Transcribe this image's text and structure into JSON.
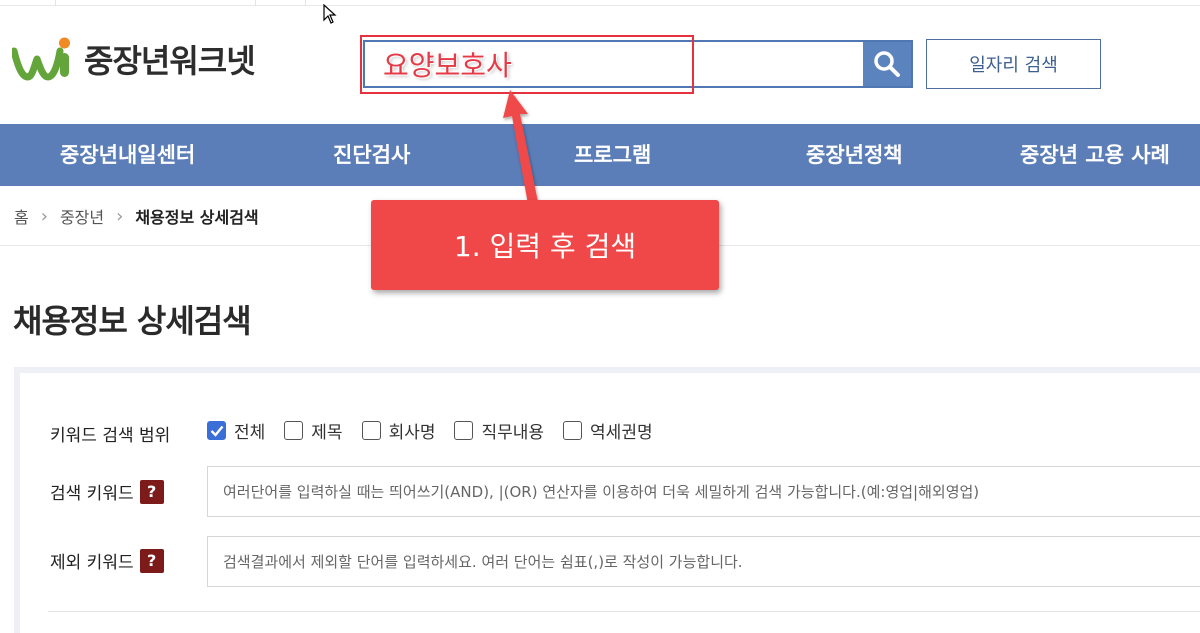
{
  "header": {
    "logo_text": "중장년워크넷",
    "search_value": "요양보호사",
    "search_button_icon": "search-icon",
    "job_search_label": "일자리 검색"
  },
  "nav": {
    "items": [
      {
        "label": "중장년내일센터"
      },
      {
        "label": "진단검사"
      },
      {
        "label": "프로그램"
      },
      {
        "label": "중장년정책"
      },
      {
        "label": "중장년 고용 사례"
      }
    ]
  },
  "breadcrumb": {
    "items": [
      "홈",
      "중장년",
      "채용정보 상세검색"
    ]
  },
  "annotation": {
    "callout_text": "1. 입력 후 검색",
    "color": "#f04848"
  },
  "page": {
    "title": "채용정보 상세검색"
  },
  "form": {
    "scope_label": "키워드 검색 범위",
    "scope_options": [
      {
        "label": "전체",
        "checked": true
      },
      {
        "label": "제목",
        "checked": false
      },
      {
        "label": "회사명",
        "checked": false
      },
      {
        "label": "직무내용",
        "checked": false
      },
      {
        "label": "역세권명",
        "checked": false
      }
    ],
    "keyword_label": "검색 키워드",
    "keyword_placeholder": "여러단어를 입력하실 때는 띄어쓰기(AND), |(OR) 연산자를 이용하여 더욱 세밀하게 검색 가능합니다.(예:영업|해외영업)",
    "exclude_label": "제외 키워드",
    "exclude_placeholder": "검색결과에서 제외할 단어를 입력하세요. 여러 단어는 쉼표(,)로 작성이 가능합니다.",
    "help_glyph": "?"
  },
  "colors": {
    "nav_bg": "#5b7db8",
    "accent_blue": "#4f77b3",
    "help_badge": "#7d1b1b",
    "highlight": "#e6323e"
  }
}
